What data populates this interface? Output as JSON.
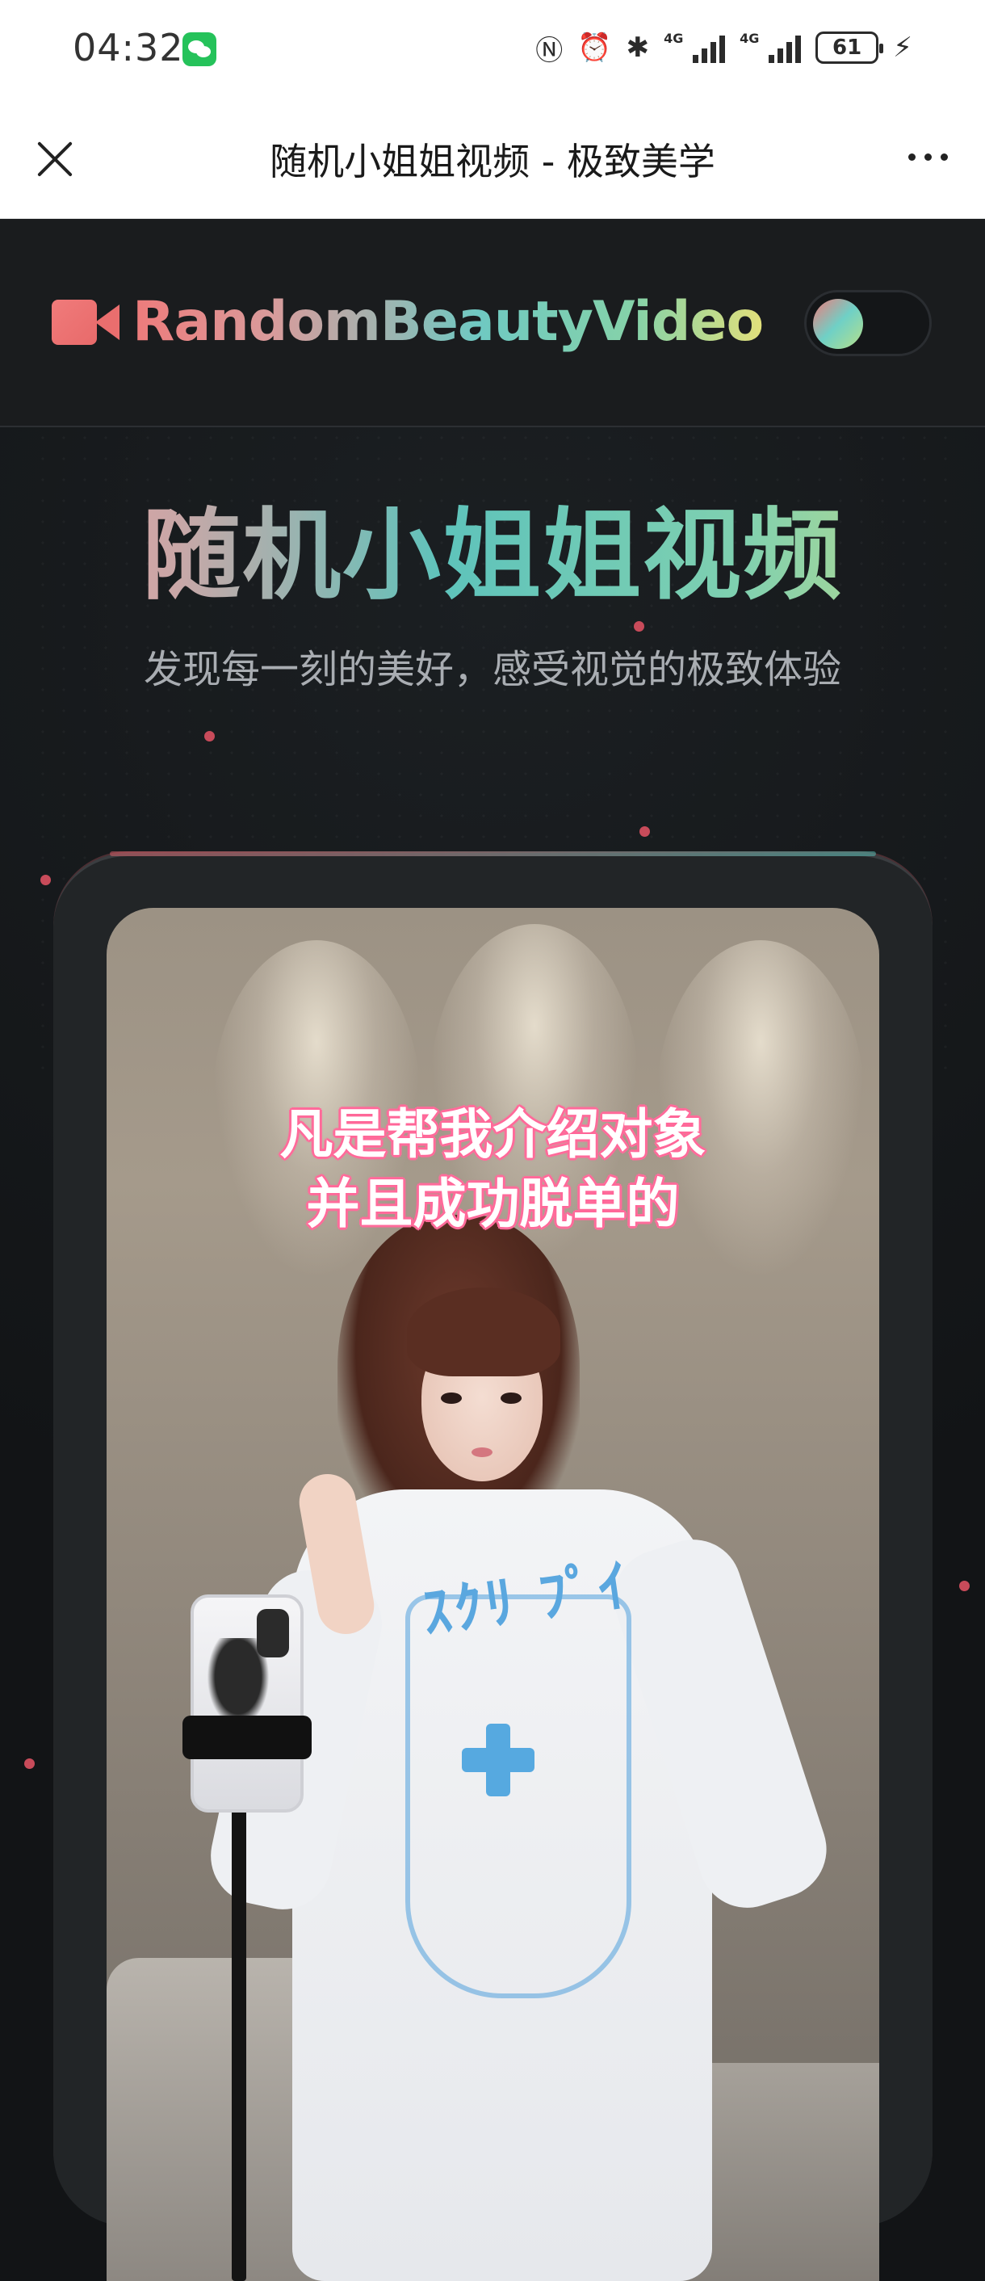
{
  "status_bar": {
    "time": "04:32",
    "icons": [
      "nfc-icon",
      "alarm-icon",
      "bluetooth-icon",
      "signal-4g-icon",
      "signal-4g-icon",
      "battery-icon",
      "charging-icon"
    ],
    "network_1": "4G",
    "network_2": "4G",
    "battery": "61"
  },
  "nav": {
    "title": "随机小姐姐视频 - 极致美学"
  },
  "header": {
    "logo_text": "RandomBeautyVideo"
  },
  "hero": {
    "title": "随机小姐姐视频",
    "subtitle": "发现每一刻的美好，感受视觉的极致体验"
  },
  "video": {
    "caption_line1": "凡是帮我介绍对象",
    "caption_line2": "并且成功脱单的",
    "shirt_text": "ｽｸﾘ ﾌﾟｲ"
  },
  "colors": {
    "accent_red": "#ee7b7b",
    "accent_teal": "#6fc9c2",
    "accent_yellow": "#e2e07b",
    "background": "#121416",
    "caption_outline": "#ff6f9c"
  }
}
